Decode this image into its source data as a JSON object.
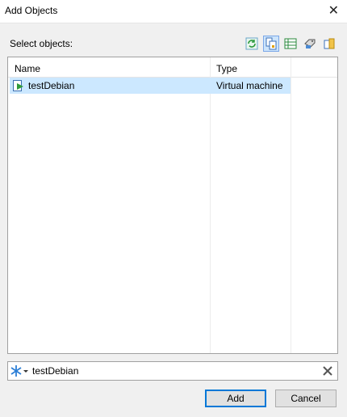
{
  "window": {
    "title": "Add Objects",
    "close_icon": "close-icon"
  },
  "select_label": "Select objects:",
  "toolbar": [
    {
      "name": "refresh-icon",
      "active": false
    },
    {
      "name": "large-icons-view-icon",
      "active": true
    },
    {
      "name": "details-view-icon",
      "active": false
    },
    {
      "name": "properties-icon",
      "active": false
    },
    {
      "name": "clipboard-icon",
      "active": false
    }
  ],
  "list": {
    "columns": [
      "Name",
      "Type"
    ],
    "rows": [
      {
        "name": "testDebian",
        "type": "Virtual machine",
        "icon": "virtual-machine-icon",
        "selected": true
      }
    ]
  },
  "search": {
    "value": "testDebian"
  },
  "buttons": {
    "add": "Add",
    "cancel": "Cancel"
  },
  "colors": {
    "selection": "#cce8ff",
    "accent": "#0078d7"
  }
}
